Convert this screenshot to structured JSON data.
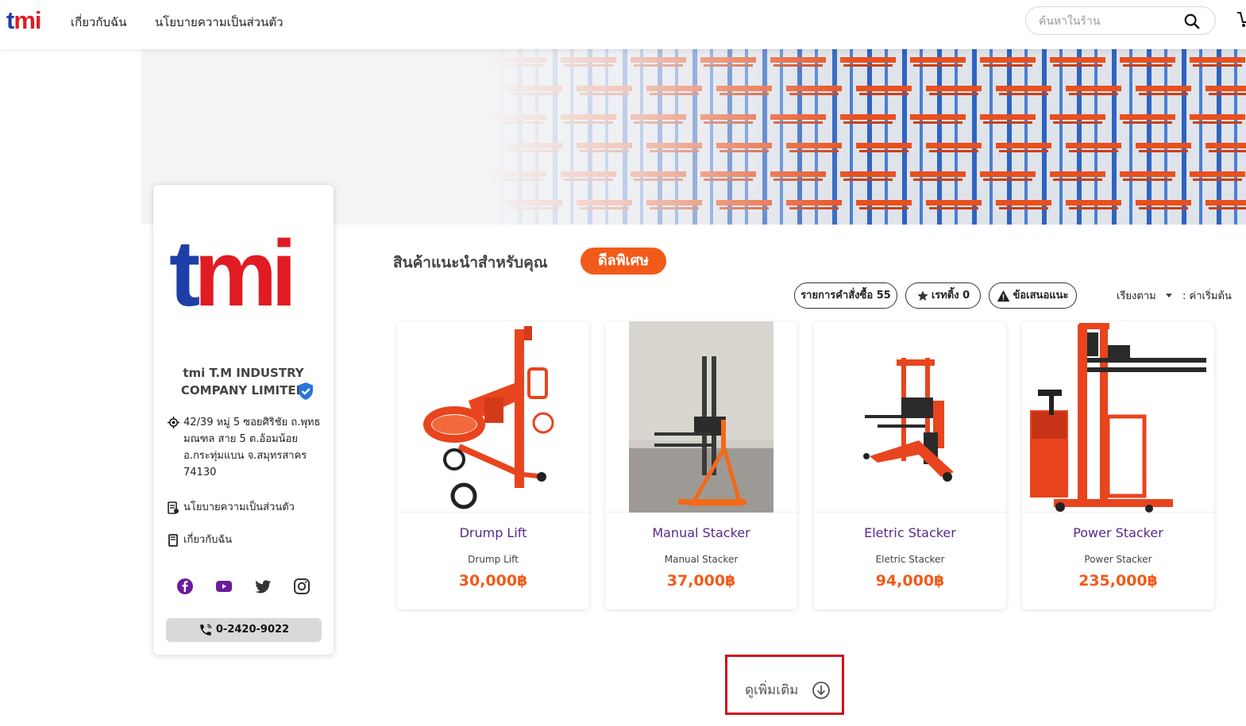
{
  "header": {
    "logo": "tmi",
    "nav": [
      "เกี่ยวกับฉัน",
      "นโยบายความเป็นส่วนตัว"
    ],
    "search_placeholder": "ค้นหาในร้าน",
    "search_icon": "search-icon",
    "cart_icon": "cart-icon"
  },
  "shop": {
    "name": "tmi T.M INDUSTRY COMPANY LIMITED",
    "address": "42/39 หมู่ 5 ซอยศิริชัย ถ.พุทธมณฑล สาย 5 ต.อ้อมน้อย อ.กระทุ่มแบน จ.สมุทรสาคร 74130",
    "links": [
      "นโยบายความเป็นส่วนตัว",
      "เกี่ยวกับฉัน"
    ],
    "phone": "0-2420-9022",
    "social_icons": [
      "facebook-icon",
      "youtube-icon",
      "twitter-icon",
      "instagram-icon"
    ]
  },
  "section": {
    "title": "สินค้าแนะนำสำหรับคุณ",
    "badge": "ดีลพิเศษ",
    "pills": [
      "รายการคำสั่งซื้อ 55",
      "เรทติ้ง 0",
      "ข้อเสนอแนะ"
    ],
    "sort_label": "เรียงตาม",
    "sort_value": ": ค่าเริ่มต้น"
  },
  "products": [
    {
      "name": "Drump Lift",
      "subtitle": "Drump Lift",
      "price": "30,000฿"
    },
    {
      "name": "Manual Stacker",
      "subtitle": "Manual Stacker",
      "price": "37,000฿"
    },
    {
      "name": "Eletric Stacker",
      "subtitle": "Eletric Stacker",
      "price": "94,000฿"
    },
    {
      "name": "Power Stacker",
      "subtitle": "Power Stacker",
      "price": "235,000฿"
    }
  ],
  "see_more": "ดูเพิ่มเติม",
  "colors": {
    "brand_blue": "#1e3fa8",
    "brand_red": "#e01b24",
    "accent_orange": "#f25a1a",
    "product_name": "#552a8c",
    "highlight_border": "#d0111b"
  }
}
